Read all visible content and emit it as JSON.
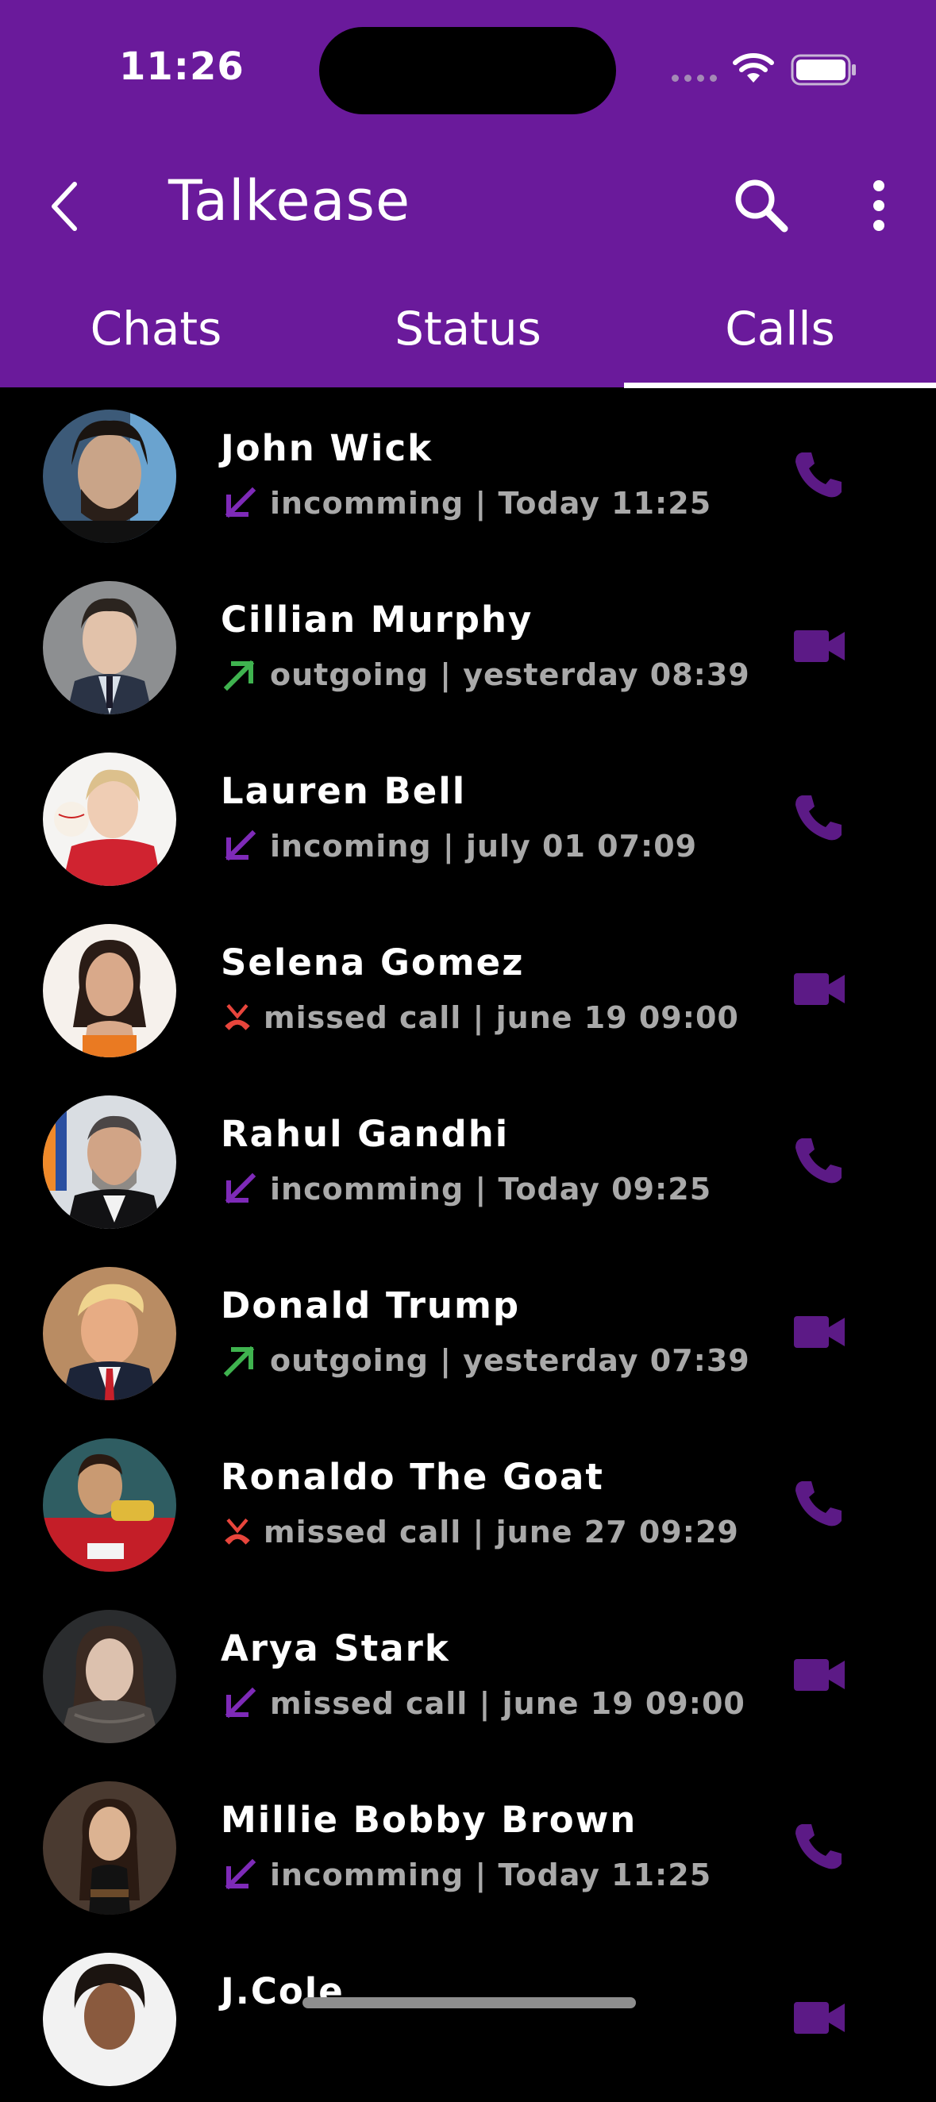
{
  "status_bar": {
    "time": "11:26"
  },
  "header": {
    "title": "Talkease",
    "background_color": "#6a1a9b",
    "back_icon": "chevron-left-icon",
    "search_icon": "search-icon",
    "menu_icon": "more-vertical-icon"
  },
  "tabs": [
    {
      "label": "Chats"
    },
    {
      "label": "Status"
    },
    {
      "label": "Calls",
      "active": true
    }
  ],
  "colors": {
    "accent": "#6a1a9b",
    "incoming": "#7e2ab8",
    "outgoing": "#3fb34f",
    "missed": "#e8453c",
    "secondary_text": "#a9a9a9"
  },
  "calls": [
    {
      "name": "John Wick",
      "direction": "incoming",
      "detail": "incomming | Today 11:25",
      "action": "voice"
    },
    {
      "name": "Cillian Murphy",
      "direction": "outgoing",
      "detail": "outgoing | yesterday 08:39",
      "action": "video"
    },
    {
      "name": "Lauren Bell",
      "direction": "incoming",
      "detail": "incoming | july 01 07:09",
      "action": "voice"
    },
    {
      "name": "Selena Gomez",
      "direction": "missed",
      "detail": "missed call | june 19 09:00",
      "action": "video"
    },
    {
      "name": "Rahul Gandhi",
      "direction": "incoming",
      "detail": "incomming | Today 09:25",
      "action": "voice"
    },
    {
      "name": "Donald Trump",
      "direction": "outgoing",
      "detail": "outgoing | yesterday 07:39",
      "action": "video"
    },
    {
      "name": "Ronaldo The Goat",
      "direction": "missed",
      "detail": "missed call | june 27 09:29",
      "action": "voice"
    },
    {
      "name": "Arya Stark",
      "direction": "incoming",
      "detail": "missed call | june 19 09:00",
      "action": "video"
    },
    {
      "name": "Millie Bobby Brown",
      "direction": "incoming",
      "detail": "incomming | Today 11:25",
      "action": "voice"
    },
    {
      "name": "J.Cole",
      "direction": "incoming",
      "detail": "",
      "action": "video"
    }
  ]
}
